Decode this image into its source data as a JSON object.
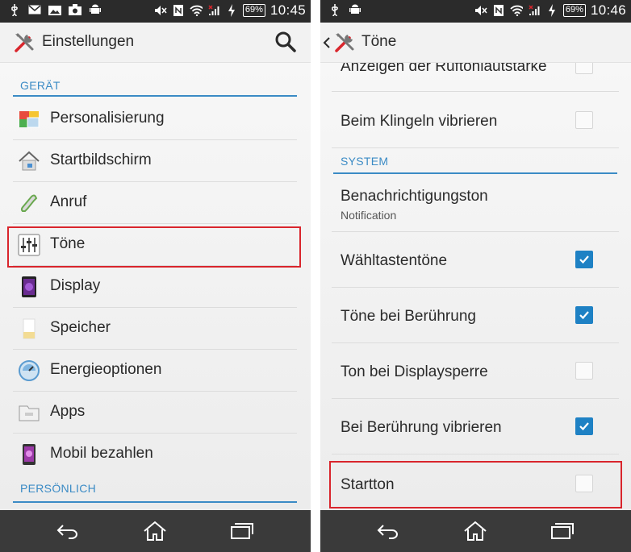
{
  "left": {
    "status": {
      "time": "10:45",
      "battery": "69%"
    },
    "title": "Einstellungen",
    "section_device": "GERÄT",
    "section_personal": "PERSÖNLICH",
    "items": [
      {
        "label": "Personalisierung",
        "icon": "personalization-icon"
      },
      {
        "label": "Startbildschirm",
        "icon": "home-screen-icon"
      },
      {
        "label": "Anruf",
        "icon": "phone-icon"
      },
      {
        "label": "Töne",
        "icon": "sound-sliders-icon"
      },
      {
        "label": "Display",
        "icon": "display-icon"
      },
      {
        "label": "Speicher",
        "icon": "storage-icon"
      },
      {
        "label": "Energieoptionen",
        "icon": "battery-gauge-icon"
      },
      {
        "label": "Apps",
        "icon": "apps-folder-icon"
      },
      {
        "label": "Mobil bezahlen",
        "icon": "mobile-payment-icon"
      }
    ]
  },
  "right": {
    "status": {
      "time": "10:46",
      "battery": "69%"
    },
    "title": "Töne",
    "partial_item": "Anzeigen der Ruftonlautstärke",
    "section_system": "SYSTEM",
    "items": [
      {
        "label": "Beim Klingeln vibrieren",
        "checked": false
      },
      {
        "label": "Benachrichtigungston",
        "sub": "Notification"
      },
      {
        "label": "Wähltastentöne",
        "checked": true
      },
      {
        "label": "Töne bei Berührung",
        "checked": true
      },
      {
        "label": "Ton bei Displaysperre",
        "checked": false
      },
      {
        "label": "Bei Berührung vibrieren",
        "checked": true
      },
      {
        "label": "Startton",
        "checked": false
      }
    ]
  },
  "colors": {
    "accent": "#3b8bc5",
    "checkbox": "#1e81c4",
    "highlight": "#d9252c",
    "statusbar": "#2b2b2b",
    "navbar": "#3a3a3a"
  }
}
